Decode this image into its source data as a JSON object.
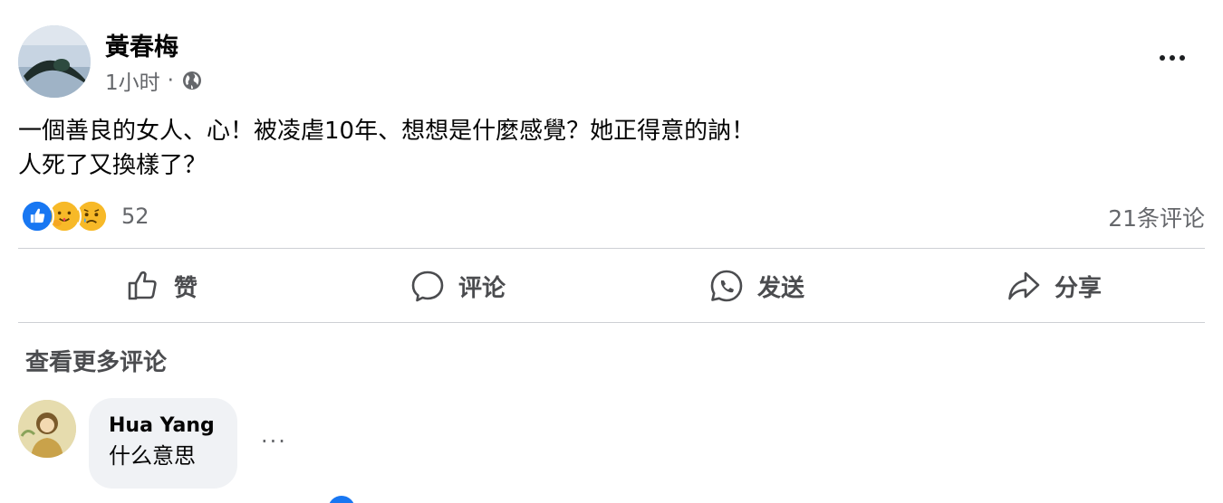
{
  "post": {
    "author": "黃春梅",
    "time": "1小时",
    "privacy_icon": "globe-icon",
    "more_icon": "more-horizontal-icon",
    "text_lines": [
      "一個善良的女人、心！被凌虐10年、想想是什麼感覺？她正得意的訥！",
      "人死了又換樣了？"
    ],
    "reactions": {
      "icons": [
        "like-reaction-icon",
        "care-reaction-icon",
        "sad-reaction-icon"
      ],
      "count": "52"
    },
    "comment_count": "21条评论"
  },
  "actions": {
    "like": "赞",
    "comment": "评论",
    "send": "发送",
    "share": "分享"
  },
  "comments": {
    "view_more": "查看更多评论",
    "items": [
      {
        "author": "Hua Yang",
        "text": "什么意思",
        "more": "···"
      }
    ]
  },
  "colors": {
    "text_primary": "#050505",
    "text_secondary": "#65676b",
    "action_text": "#4b4c4f",
    "divider": "#ced0d4",
    "bubble_bg": "#f0f2f5",
    "like_blue": "#1877f2",
    "reaction_yellow": "#f7b928"
  }
}
